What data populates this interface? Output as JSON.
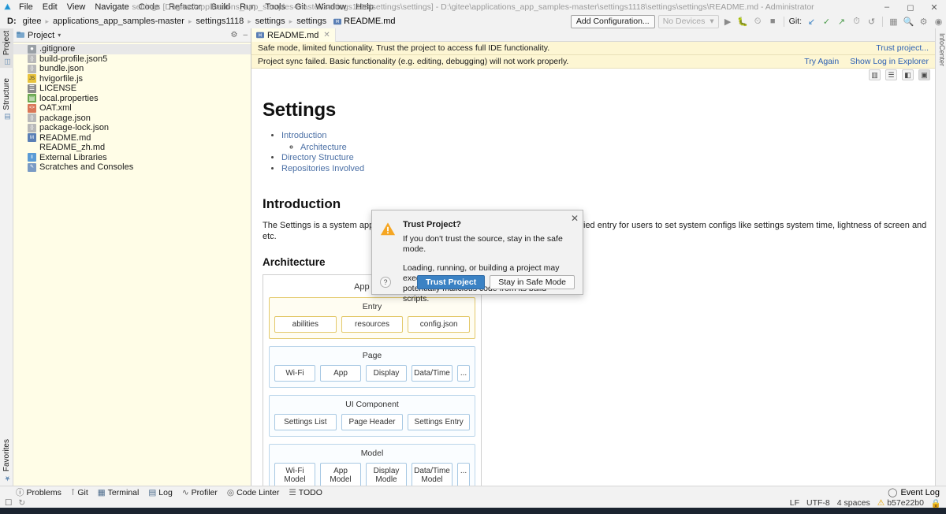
{
  "titlebar": {
    "logo_icon": "deveco-logo-icon",
    "title": "settings [D:\\gitee\\applications_app_samples-master\\settings1118\\settings\\settings] - D:\\gitee\\applications_app_samples-master\\settings1118\\settings\\settings\\README.md - Administrator",
    "menus": [
      "File",
      "Edit",
      "View",
      "Navigate",
      "Code",
      "Refactor",
      "Build",
      "Run",
      "Tools",
      "Git",
      "Window",
      "Help"
    ],
    "window_buttons": [
      "minimize",
      "maximize",
      "close"
    ]
  },
  "navbar": {
    "drive": "D:",
    "crumbs": [
      "gitee",
      "applications_app_samples-master",
      "settings1118",
      "settings",
      "settings"
    ],
    "file": "README.md",
    "add_configuration": "Add Configuration...",
    "devices": "No Devices",
    "git_label": "Git:",
    "run_icons": [
      "run-icon",
      "debug-icon",
      "profile-icon",
      "stop-icon"
    ],
    "git_icons": [
      "update-project-icon",
      "commit-icon",
      "push-icon",
      "history-icon",
      "rollback-icon"
    ],
    "right_icons": [
      "project-structure-icon",
      "search-icon",
      "settings-gear-icon",
      "account-icon"
    ]
  },
  "left_strip": {
    "tabs": [
      {
        "label": "Project",
        "icon": "project-icon",
        "selected": true
      },
      {
        "label": "Structure",
        "icon": "structure-icon",
        "selected": false
      }
    ],
    "bottom_tabs": [
      {
        "label": "Favorites",
        "icon": "star-icon",
        "selected": false
      }
    ]
  },
  "right_strip": {
    "label": "InfoCenter"
  },
  "project_panel": {
    "title": "Project",
    "dropdown_icon": "chevron-down-icon",
    "settings_icon": "gear-icon",
    "collapse_icon": "minimize-icon",
    "items": [
      {
        "label": ".gitignore",
        "icon": "git-file-icon",
        "color": "#9aa0a6",
        "glyph": "■",
        "selected": true
      },
      {
        "label": "build-profile.json5",
        "icon": "json-file-icon",
        "color": "#b8b8b8",
        "glyph": "{}",
        "selected": false
      },
      {
        "label": "bundle.json",
        "icon": "json-file-icon",
        "color": "#b8b8b8",
        "glyph": "{}",
        "selected": false
      },
      {
        "label": "hvigorfile.js",
        "icon": "js-file-icon",
        "color": "#e8c33c",
        "glyph": "JS",
        "selected": false
      },
      {
        "label": "LICENSE",
        "icon": "text-file-icon",
        "color": "#8a8a8a",
        "glyph": "▤",
        "selected": false
      },
      {
        "label": "local.properties",
        "icon": "properties-file-icon",
        "color": "#6aa84f",
        "glyph": "▦",
        "selected": false
      },
      {
        "label": "OAT.xml",
        "icon": "xml-file-icon",
        "color": "#d97757",
        "glyph": "<>",
        "selected": false
      },
      {
        "label": "package.json",
        "icon": "json-file-icon",
        "color": "#b8b8b8",
        "glyph": "{}",
        "selected": false
      },
      {
        "label": "package-lock.json",
        "icon": "json-file-icon",
        "color": "#b8b8b8",
        "glyph": "{}",
        "selected": false
      },
      {
        "label": "README.md",
        "icon": "markdown-file-icon",
        "color": "#5a7fb5",
        "glyph": "M↓",
        "selected": false
      },
      {
        "label": "README_zh.md",
        "icon": "none",
        "color": "transparent",
        "glyph": "",
        "selected": false
      },
      {
        "label": "External Libraries",
        "icon": "library-icon",
        "color": "#5a9bd5",
        "glyph": "‖",
        "selected": false
      },
      {
        "label": "Scratches and Consoles",
        "icon": "scratches-icon",
        "color": "#7a9bc4",
        "glyph": "✎",
        "selected": false
      }
    ]
  },
  "editor": {
    "tab": {
      "label": "README.md",
      "icon": "markdown-file-icon",
      "close_icon": "close-icon"
    },
    "notifications": [
      {
        "text": "Safe mode, limited functionality. Trust the project to access full IDE functionality.",
        "links": [
          "Trust project..."
        ]
      },
      {
        "text": "Project sync failed. Basic functionality (e.g. editing, debugging) will not work properly.",
        "links": [
          "Try Again",
          "Show Log in Explorer"
        ]
      }
    ],
    "view_buttons": [
      {
        "name": "split-view-icon",
        "glyph": "▥",
        "active": false
      },
      {
        "name": "editor-only-icon",
        "glyph": "☰",
        "active": false
      },
      {
        "name": "preview-split-icon",
        "glyph": "◧",
        "active": false
      },
      {
        "name": "preview-only-icon",
        "glyph": "▣",
        "active": true
      }
    ]
  },
  "markdown": {
    "h1": "Settings",
    "toc": [
      {
        "label": "Introduction",
        "children": [
          {
            "label": "Architecture"
          }
        ]
      },
      {
        "label": "Directory Structure",
        "children": []
      },
      {
        "label": "Repositories Involved",
        "children": []
      }
    ],
    "h2_introduction": "Introduction",
    "intro_paragraph": "The Settings is a system application preinstalled in OpenHarmony. It provides a unified entry for users to set system configs like settings system time, lightness of screen and etc.",
    "h3_architecture": "Architecture",
    "diagram": {
      "root_title": "App Root",
      "groups": [
        {
          "title": "Entry",
          "style": "yellow",
          "cells": [
            {
              "label": "abilities",
              "narrow": false
            },
            {
              "label": "resources",
              "narrow": false
            },
            {
              "label": "config.json",
              "narrow": false
            }
          ]
        },
        {
          "title": "Page",
          "style": "blue",
          "cells": [
            {
              "label": "Wi-Fi",
              "narrow": false
            },
            {
              "label": "App",
              "narrow": false
            },
            {
              "label": "Display",
              "narrow": false
            },
            {
              "label": "Data/Time",
              "narrow": false
            },
            {
              "label": "...",
              "narrow": true
            }
          ]
        },
        {
          "title": "UI Component",
          "style": "blue",
          "cells": [
            {
              "label": "Settings List",
              "narrow": false
            },
            {
              "label": "Page Header",
              "narrow": false
            },
            {
              "label": "Settings Entry",
              "narrow": false
            }
          ]
        },
        {
          "title": "Model",
          "style": "blue",
          "cells": [
            {
              "label": "Wi-Fi Model",
              "narrow": false
            },
            {
              "label": "App Model",
              "narrow": false
            },
            {
              "label": "Display Modle",
              "narrow": false
            },
            {
              "label": "Data/Time Model",
              "narrow": false
            },
            {
              "label": "...",
              "narrow": true
            }
          ]
        }
      ]
    }
  },
  "dialog": {
    "title": "Trust Project?",
    "warning_icon": "warning-triangle-icon",
    "close_icon": "close-icon",
    "line1": "If you don't trust the source, stay in the safe mode.",
    "line2": "Loading, running, or building a project may execute",
    "line3": "potentially malicious code from its build scripts.",
    "help_label": "?",
    "primary_button": "Trust Project",
    "secondary_button": "Stay in Safe Mode"
  },
  "bottom_bar": {
    "items": [
      {
        "label": "Problems",
        "icon": "problems-icon",
        "glyph": "ⓘ"
      },
      {
        "label": "Git",
        "icon": "git-icon",
        "glyph": "⎇"
      },
      {
        "label": "Terminal",
        "icon": "terminal-icon",
        "glyph": "▣"
      },
      {
        "label": "Log",
        "icon": "log-icon",
        "glyph": "▤"
      },
      {
        "label": "Profiler",
        "icon": "profiler-icon",
        "glyph": "∿"
      },
      {
        "label": "Code Linter",
        "icon": "code-linter-icon",
        "glyph": "◎"
      },
      {
        "label": "TODO",
        "icon": "todo-icon",
        "glyph": "☰"
      }
    ],
    "event_log": "Event Log",
    "event_log_icon": "event-log-icon"
  },
  "status_bar": {
    "left_icons": [
      "toggle-toolwindows-icon",
      "background-tasks-icon"
    ],
    "line_separator": "LF",
    "encoding": "UTF-8",
    "indent": "4 spaces",
    "branch": "b57e22b0",
    "branch_icon": "warning-icon",
    "lock_icon": "lock-icon"
  },
  "colors": {
    "accent_blue": "#3b82c4",
    "notification_bg": "#fdf6d3",
    "panel_bg": "#fffde7",
    "link": "#2b5fb3",
    "warning": "#f0a500"
  }
}
